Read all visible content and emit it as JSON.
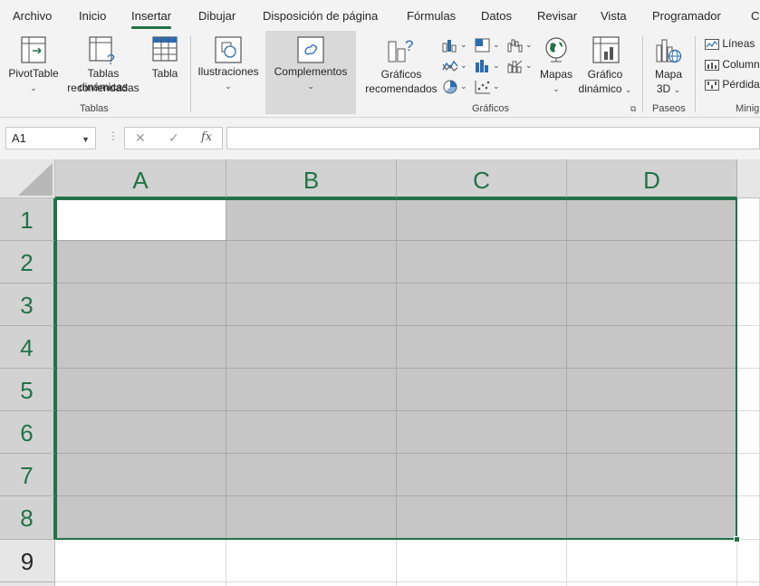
{
  "tabs": [
    "Archivo",
    "Inicio",
    "Insertar",
    "Dibujar",
    "Disposición de página",
    "Fórmulas",
    "Datos",
    "Revisar",
    "Vista",
    "Programador",
    "Co"
  ],
  "active_tab": "Insertar",
  "ribbon": {
    "pivottable": "PivotTable",
    "recommended_pivot_1": "Tablas dinámicas",
    "recommended_pivot_2": "recomendadas",
    "table": "Tabla",
    "group_tables": "Tablas",
    "illustrations": "Ilustraciones",
    "addins": "Complementos",
    "recommended_charts_1": "Gráficos",
    "recommended_charts_2": "recomendados",
    "maps": "Mapas",
    "pivot_chart_1": "Gráfico",
    "pivot_chart_2": "dinámico",
    "group_charts": "Gráficos",
    "map3d_1": "Mapa",
    "map3d_2": "3D",
    "group_tours": "Paseos",
    "sparklines": [
      "Líneas",
      "Column",
      "Pérdidas"
    ],
    "group_sparklines": "Minig"
  },
  "formula_bar": {
    "name_box": "A1",
    "cancel": "✕",
    "enter": "✓",
    "function": "fx",
    "content": ""
  },
  "grid": {
    "columns": [
      "A",
      "B",
      "C",
      "D"
    ],
    "rows": [
      "1",
      "2",
      "3",
      "4",
      "5",
      "6",
      "7",
      "8",
      "9"
    ],
    "selected_range": "A1:D8",
    "active_cell": "A1"
  },
  "colors": {
    "accent": "#217346",
    "selection": "#c6c6c6",
    "ribbon_bg": "#f3f3f3"
  }
}
